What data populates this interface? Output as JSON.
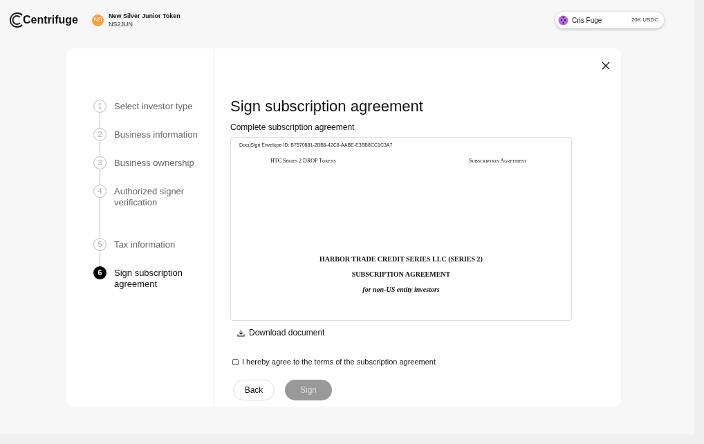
{
  "header": {
    "logo": "Centrifuge",
    "token": {
      "icon_text": "NS",
      "name": "New Silver Junior Token",
      "symbol": "NS2JUN"
    },
    "account": {
      "name": "Cris Fuge",
      "balance": "20K USDC"
    }
  },
  "steps": [
    {
      "number": "1",
      "label": "Select investor type",
      "selected": false
    },
    {
      "number": "2",
      "label": "Business information",
      "selected": false
    },
    {
      "number": "3",
      "label": "Business ownership",
      "selected": false
    },
    {
      "number": "4",
      "label": "Authorized signer verification",
      "selected": false
    },
    {
      "number": "5",
      "label": "Tax information",
      "selected": false
    },
    {
      "number": "6",
      "label": "Sign subscription agreement",
      "selected": true
    }
  ],
  "title": "Sign subscription agreement",
  "subtitle": "Complete subscription agreement",
  "document": {
    "envelope_id": "DocuSign Envelope ID: B7570881-2BB5-42C8-AABE-E3BB8CC1C3A7",
    "header_left": "HTC Series 2 DROP Tokens",
    "header_right": "Subscription Agreement",
    "heading": "HARBOR TRADE CREDIT SERIES LLC (SERIES 2)",
    "subheading": "SUBSCRIPTION AGREEMENT",
    "note": "for non-US entity investors"
  },
  "download_link": "Download document",
  "agreement": {
    "label": "I hereby agree to the terms of the subscription agreement",
    "checked": false
  },
  "buttons": [
    {
      "label": "Back",
      "disabled": false
    },
    {
      "label": "Sign",
      "disabled": true
    }
  ]
}
